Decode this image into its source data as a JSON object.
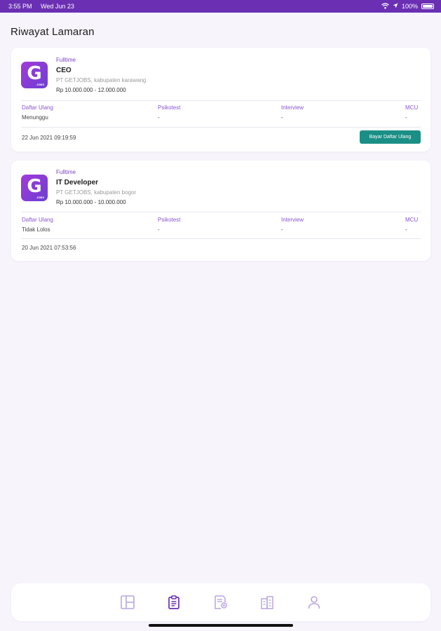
{
  "status_bar": {
    "time": "3:55 PM",
    "date": "Wed Jun 23",
    "battery": "100%"
  },
  "page": {
    "title": "Riwayat Lamaran"
  },
  "applications": [
    {
      "logo_letter": "G",
      "logo_text": "JOBS",
      "job_type": "Fulltime",
      "title": "CEO",
      "company": "PT GETJOBS, kabupaten karawang",
      "salary": "Rp 10.000.000 - 12.000.000",
      "stages": [
        {
          "label": "Daftar Ulang",
          "value": "Menunggu"
        },
        {
          "label": "Psikotest",
          "value": "-"
        },
        {
          "label": "Interview",
          "value": "-"
        },
        {
          "label": "MCU",
          "value": "-"
        }
      ],
      "date": "22 Jun 2021 09:19:59",
      "action_label": "Bayar Daftar Ulang"
    },
    {
      "logo_letter": "G",
      "logo_text": "JOBS",
      "job_type": "Fulltime",
      "title": "IT Developer",
      "company": "PT GETJOBS, kabupaten bogor",
      "salary": "Rp 10.000.000 - 10.000.000",
      "stages": [
        {
          "label": "Daftar Ulang",
          "value": "Tidak Lolos"
        },
        {
          "label": "Psikotest",
          "value": "-"
        },
        {
          "label": "Interview",
          "value": "-"
        },
        {
          "label": "MCU",
          "value": "-"
        }
      ],
      "date": "20 Jun 2021 07:53:56"
    }
  ],
  "bottom_nav": {
    "items": [
      {
        "icon": "dashboard-icon",
        "active": false
      },
      {
        "icon": "clipboard-icon",
        "active": true
      },
      {
        "icon": "document-search-icon",
        "active": false
      },
      {
        "icon": "building-icon",
        "active": false
      },
      {
        "icon": "user-icon",
        "active": false
      }
    ]
  },
  "colors": {
    "primary": "#6a2fb3",
    "accent_purple": "#8a55d1",
    "action_teal": "#1a8f86",
    "background": "#f7f4fc",
    "nav_inactive": "#b9a6de",
    "nav_active": "#6a2fb3"
  }
}
